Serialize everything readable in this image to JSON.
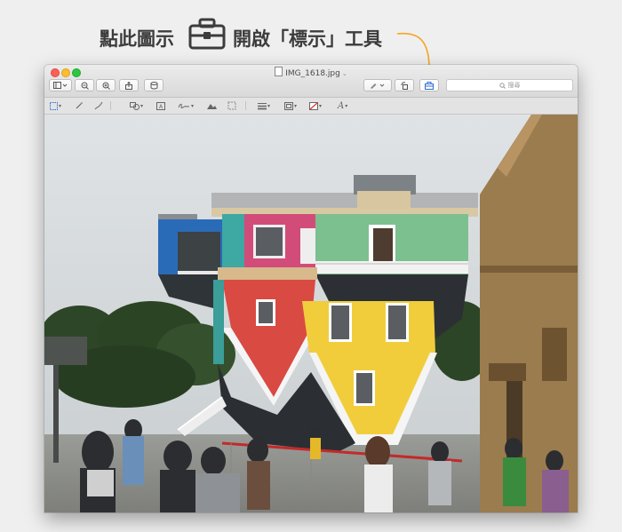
{
  "caption": {
    "before_icon": "點此圖示",
    "after_icon": "開啟「標示」工具",
    "icon": "toolbox-icon",
    "callout_color": "#f6a623"
  },
  "window": {
    "filename": "IMG_1618.jpg",
    "search_placeholder": "搜尋"
  },
  "toolbar_icons": [
    "sidebar-icon",
    "zoom-out-icon",
    "zoom-in-icon",
    "share-icon",
    "rotate-icon",
    "pen-icon",
    "rotate-left-icon",
    "toolbox-icon",
    "search-icon"
  ],
  "markup_icons": [
    "rect-select-icon",
    "instant-alpha-icon",
    "sketch-icon",
    "shapes-icon",
    "text-icon",
    "sign-icon",
    "adjust-color-icon",
    "adjust-size-icon",
    "line-style-icon",
    "border-color-icon",
    "fill-color-icon",
    "font-style-icon"
  ],
  "colors": {
    "callout": "#f6a623",
    "accent": "#2d6bd6"
  }
}
